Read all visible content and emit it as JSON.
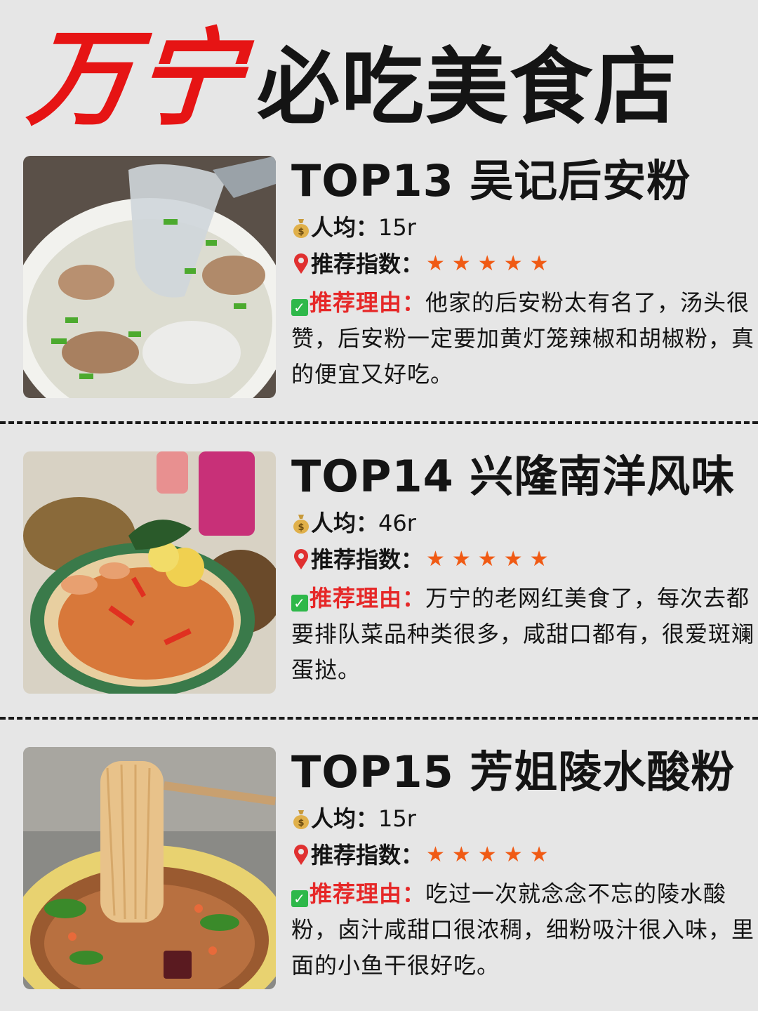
{
  "header": {
    "title_red": "万宁",
    "title_black": "必吃美食店"
  },
  "shops": [
    {
      "title": "TOP13 吴记后安粉",
      "price_label": "人均：",
      "price_value": "15r",
      "rating_label": "推荐指数：",
      "rating_stars": "★★★★★",
      "rating_value": 5,
      "reason_label": "推荐理由：",
      "reason_text": "他家的后安粉太有名了，汤头很赞，后安粉一定要加黄灯笼辣椒和胡椒粉，真的便宜又好吃。"
    },
    {
      "title": "TOP14 兴隆南洋风味",
      "price_label": "人均：",
      "price_value": "46r",
      "rating_label": "推荐指数：",
      "rating_stars": "★★★★★",
      "rating_value": 5,
      "reason_label": "推荐理由：",
      "reason_text": "万宁的老网红美食了，每次去都要排队菜品种类很多，咸甜口都有，很爱斑斓蛋挞。"
    },
    {
      "title": "TOP15 芳姐陵水酸粉",
      "price_label": "人均：",
      "price_value": "15r",
      "rating_label": "推荐指数：",
      "rating_stars": "★★★★★",
      "rating_value": 5,
      "reason_label": "推荐理由：",
      "reason_text": "吃过一次就念念不忘的陵水酸粉，卤汁咸甜口很浓稠，细粉吸汁很入味，里面的小鱼干很好吃。"
    }
  ],
  "colors": {
    "accent_red": "#e61414",
    "star_orange": "#f05a14",
    "check_green": "#2eb84a",
    "background": "#e6e6e6"
  }
}
